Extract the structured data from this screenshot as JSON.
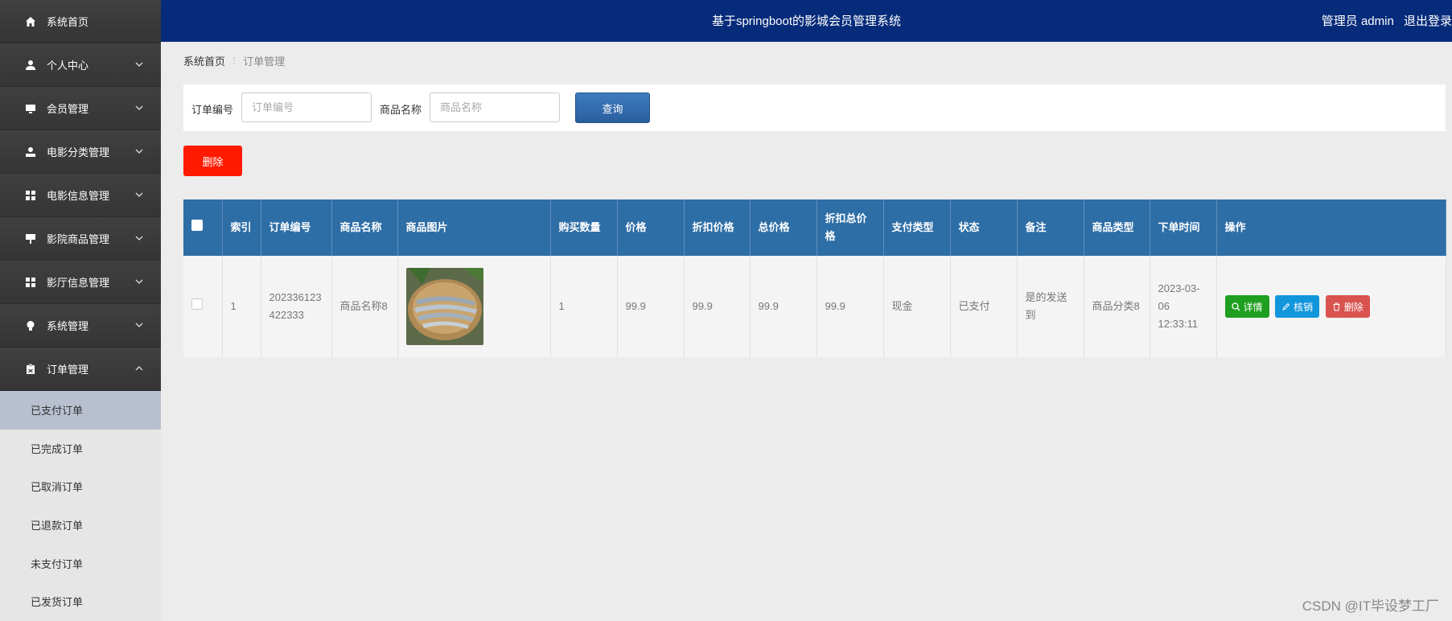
{
  "app": {
    "title": "基于springboot的影城会员管理系统",
    "user_label": "管理员 admin",
    "logout_label": "退出登录"
  },
  "sidebar": {
    "items": [
      {
        "label": "系统首页",
        "icon": "home-icon",
        "expandable": false
      },
      {
        "label": "个人中心",
        "icon": "user-icon",
        "expandable": true
      },
      {
        "label": "会员管理",
        "icon": "monitor-icon",
        "expandable": true
      },
      {
        "label": "电影分类管理",
        "icon": "person-badge-icon",
        "expandable": true
      },
      {
        "label": "电影信息管理",
        "icon": "grid-icon",
        "expandable": true
      },
      {
        "label": "影院商品管理",
        "icon": "sign-icon",
        "expandable": true
      },
      {
        "label": "影厅信息管理",
        "icon": "grid-icon",
        "expandable": true
      },
      {
        "label": "系统管理",
        "icon": "bulb-icon",
        "expandable": true
      },
      {
        "label": "订单管理",
        "icon": "clipboard-icon",
        "expandable": true,
        "expanded": true
      }
    ],
    "submenu": [
      {
        "label": "已支付订单",
        "active": true
      },
      {
        "label": "已完成订单"
      },
      {
        "label": "已取消订单"
      },
      {
        "label": "已退款订单"
      },
      {
        "label": "未支付订单"
      },
      {
        "label": "已发货订单"
      }
    ]
  },
  "breadcrumb": {
    "home": "系统首页",
    "current": "订单管理"
  },
  "search": {
    "order_no_label": "订单编号",
    "order_no_placeholder": "订单编号",
    "product_name_label": "商品名称",
    "product_name_placeholder": "商品名称",
    "query_button": "查询"
  },
  "toolbar": {
    "delete_label": "删除"
  },
  "table": {
    "columns": [
      "索引",
      "订单编号",
      "商品名称",
      "商品图片",
      "购买数量",
      "价格",
      "折扣价格",
      "总价格",
      "折扣总价格",
      "支付类型",
      "状态",
      "备注",
      "商品类型",
      "下单时间",
      "操作"
    ],
    "rows": [
      {
        "index": "1",
        "order_no": "202336123422333",
        "product_name": "商品名称8",
        "quantity": "1",
        "price": "99.9",
        "discount_price": "99.9",
        "total_price": "99.9",
        "discount_total": "99.9",
        "pay_type": "现金",
        "status": "已支付",
        "remark": "是的发送到",
        "product_type": "商品分类8",
        "order_time": "2023-03-06 12:33:11"
      }
    ],
    "actions": {
      "detail": "详情",
      "edit": "核销",
      "delete": "删除"
    }
  },
  "watermark": "CSDN @IT毕设梦工厂",
  "colors": {
    "header_bg": "#062b7a",
    "sidebar_bg": "#3a3a3a",
    "table_header_bg": "#2e6ea6",
    "detail_btn": "#1f9f1f",
    "edit_btn": "#1296db",
    "delete_btn": "#d9534f",
    "batch_delete_btn": "#ff1a00"
  }
}
